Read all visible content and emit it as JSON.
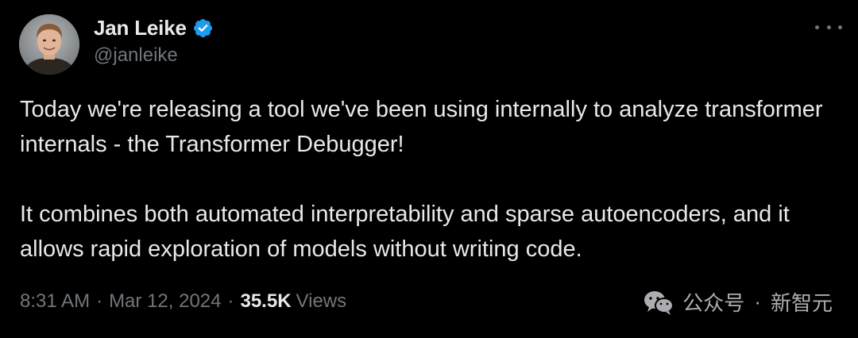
{
  "author": {
    "display_name": "Jan Leike",
    "handle": "@janleike",
    "verified": true
  },
  "tweet": {
    "paragraphs": [
      "Today we're releasing a tool we've been using internally to analyze transformer internals - the Transformer Debugger!",
      "It combines both automated interpretability and sparse autoencoders, and it allows rapid exploration of models without writing code."
    ]
  },
  "meta": {
    "time": "8:31 AM",
    "separator": "·",
    "date": "Mar 12, 2024",
    "views_count": "35.5K",
    "views_label": "Views"
  },
  "watermark": {
    "left": "公众号",
    "dot": "·",
    "right": "新智元"
  },
  "colors": {
    "background": "#000000",
    "text_primary": "#e7e9ea",
    "text_secondary": "#71767b",
    "verified_badge": "#1d9bf0"
  }
}
